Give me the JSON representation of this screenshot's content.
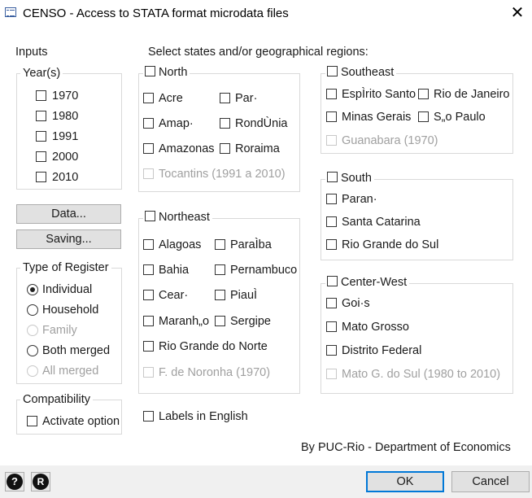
{
  "window": {
    "title": "CENSO - Access to STATA format microdata files",
    "close": "✕"
  },
  "inputs": {
    "label": "Inputs",
    "years_legend": "Year(s)",
    "years": [
      "1970",
      "1980",
      "1991",
      "2000",
      "2010"
    ],
    "data_button": "Data...",
    "saving_button": "Saving..."
  },
  "register": {
    "legend": "Type of Register",
    "options": [
      "Individual",
      "Household",
      "Family",
      "Both merged",
      "All merged"
    ],
    "selected": "Individual"
  },
  "compat": {
    "legend": "Compatibility",
    "option": "Activate option"
  },
  "regions_heading": "Select states and/or geographical regions:",
  "north": {
    "legend": "North",
    "states": [
      "Acre",
      "Par·",
      "Amap·",
      "RondÙnia",
      "Amazonas",
      "Roraima"
    ],
    "disabled": "Tocantins (1991 a 2010)"
  },
  "northeast": {
    "legend": "Northeast",
    "states": [
      "Alagoas",
      "ParaÌba",
      "Bahia",
      "Pernambuco",
      "Cear·",
      "PiauÌ",
      "Maranh„o",
      "Sergipe",
      "Rio Grande do Norte"
    ],
    "disabled": "F. de Noronha (1970)"
  },
  "southeast": {
    "legend": "Southeast",
    "states": [
      "EspÌrito Santo",
      "Rio de Janeiro",
      "Minas Gerais",
      "S„o Paulo"
    ],
    "disabled": "Guanabara (1970)"
  },
  "south": {
    "legend": "South",
    "states": [
      "Paran·",
      "Santa Catarina",
      "Rio Grande do Sul"
    ]
  },
  "centerwest": {
    "legend": "Center-West",
    "states": [
      "Goi·s",
      "Mato Grosso",
      "Distrito Federal"
    ],
    "disabled": "Mato G. do Sul (1980 to 2010)"
  },
  "labels_english": "Labels in English",
  "credit": "By PUC-Rio - Department of Economics",
  "footer": {
    "help_icon": "?",
    "r_icon": "R",
    "ok": "OK",
    "cancel": "Cancel"
  },
  "colors": {
    "accent_border": "#0078d7",
    "disabled_text": "#a0a0a0"
  }
}
